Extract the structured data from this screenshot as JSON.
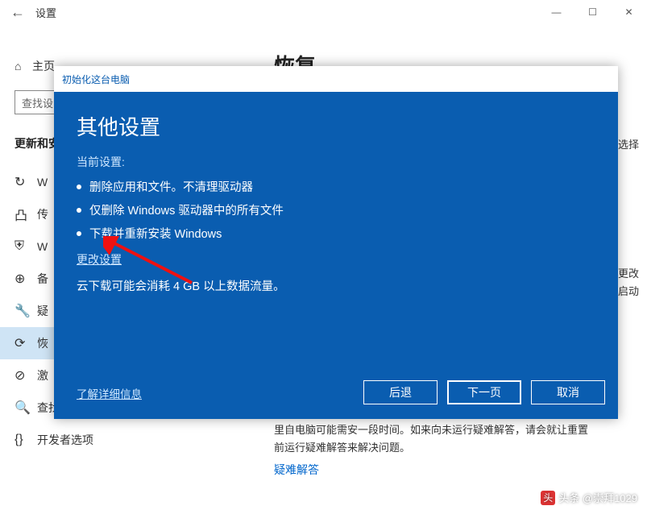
{
  "titlebar": {
    "back_glyph": "←",
    "title": "设置",
    "min_glyph": "—",
    "max_glyph": "☐",
    "close_glyph": "✕"
  },
  "sidebar": {
    "home_icon": "⌂",
    "home_label": "主页",
    "search_placeholder": "查找设",
    "section_header": "更新和安",
    "items": [
      {
        "icon": "↻",
        "label": "W"
      },
      {
        "icon": "凸",
        "label": "传"
      },
      {
        "icon": "⛨",
        "label": "W"
      },
      {
        "icon": "⊕",
        "label": "备"
      },
      {
        "icon": "🔧",
        "label": "疑"
      },
      {
        "icon": "⟳",
        "label": "恢",
        "active": true
      },
      {
        "icon": "⊘",
        "label": "激"
      },
      {
        "icon": "🔍",
        "label": "查找我的设备"
      },
      {
        "icon": "{}",
        "label": "开发者选项"
      }
    ]
  },
  "content": {
    "heading": "恢复",
    "side_text_1": "选择",
    "side_text_2a": "更改",
    "side_text_2b": "启动",
    "reset_note_1": "里自电脑可能需安一段时间。如来向未运行疑难解答，请会就让重置",
    "reset_note_2": "前运行疑难解答来解决问题。",
    "troubleshoot_link": "疑难解答"
  },
  "dialog": {
    "window_title": "初始化这台电脑",
    "heading": "其他设置",
    "current_label": "当前设置:",
    "bullets": [
      "删除应用和文件。不清理驱动器",
      "仅删除 Windows 驱动器中的所有文件",
      "下载并重新安装 Windows"
    ],
    "change_link": "更改设置",
    "cloud_note": "云下载可能会消耗 4 GB 以上数据流量。",
    "more_info": "了解详细信息",
    "buttons": {
      "back": "后退",
      "next": "下一页",
      "cancel": "取消"
    }
  },
  "watermark": "头条 @崇拜1029"
}
